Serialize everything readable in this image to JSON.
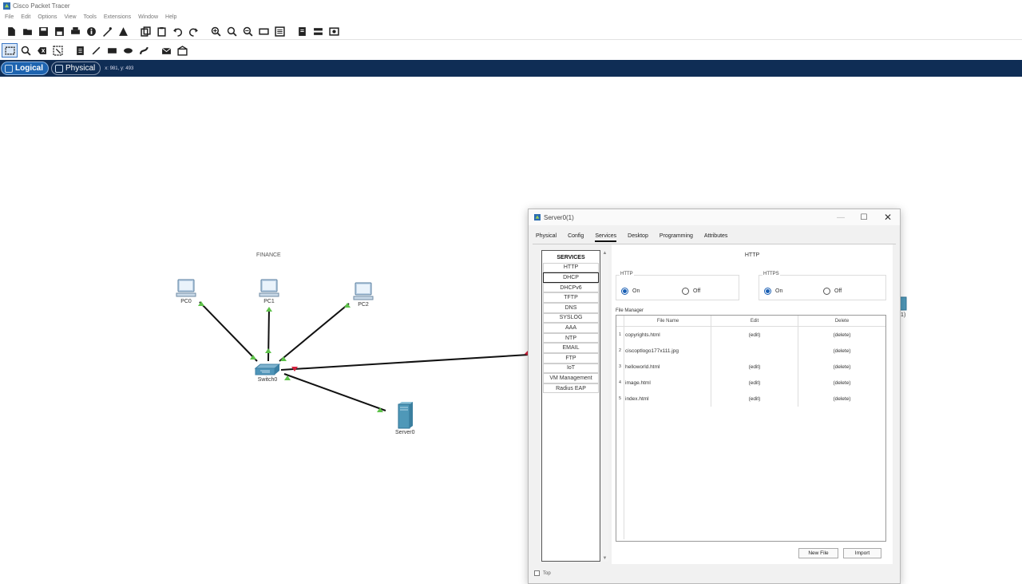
{
  "app": {
    "title": "Cisco Packet Tracer"
  },
  "menu": [
    "File",
    "Edit",
    "Options",
    "View",
    "Tools",
    "Extensions",
    "Window",
    "Help"
  ],
  "modes": {
    "logical": "Logical",
    "physical": "Physical",
    "coords": "x: 981, y: 493"
  },
  "workspace": {
    "note": "FINANCE",
    "devices": {
      "pc0": "PC0",
      "pc1": "PC1",
      "pc2": "PC2",
      "switch0": "Switch0",
      "server0": "Server0",
      "partial": "(1)"
    }
  },
  "dialog": {
    "title": "Server0(1)",
    "tabs": [
      "Physical",
      "Config",
      "Services",
      "Desktop",
      "Programming",
      "Attributes"
    ],
    "active_tab": "Services",
    "services": [
      "SERVICES",
      "HTTP",
      "DHCP",
      "DHCPv6",
      "TFTP",
      "DNS",
      "SYSLOG",
      "AAA",
      "NTP",
      "EMAIL",
      "FTP",
      "IoT",
      "VM Management",
      "Radius EAP"
    ],
    "selected_service": "DHCP",
    "heading": "HTTP",
    "http": {
      "legend": "HTTP",
      "on": "On",
      "off": "Off",
      "state": "On"
    },
    "https": {
      "legend": "HTTPS",
      "on": "On",
      "off": "Off",
      "state": "On"
    },
    "file_manager": {
      "label": "File Manager",
      "columns": [
        "File Name",
        "Edit",
        "Delete"
      ],
      "rows": [
        {
          "idx": "1",
          "name": "copyrights.html",
          "edit": "(edit)",
          "del": "(delete)"
        },
        {
          "idx": "2",
          "name": "ciscoptlogo177x111.jpg",
          "edit": "",
          "del": "(delete)"
        },
        {
          "idx": "3",
          "name": "helloworld.html",
          "edit": "(edit)",
          "del": "(delete)"
        },
        {
          "idx": "4",
          "name": "image.html",
          "edit": "(edit)",
          "del": "(delete)"
        },
        {
          "idx": "5",
          "name": "index.html",
          "edit": "(edit)",
          "del": "(delete)"
        }
      ]
    },
    "buttons": {
      "new_file": "New File",
      "import": "Import"
    },
    "footer": "Top"
  }
}
